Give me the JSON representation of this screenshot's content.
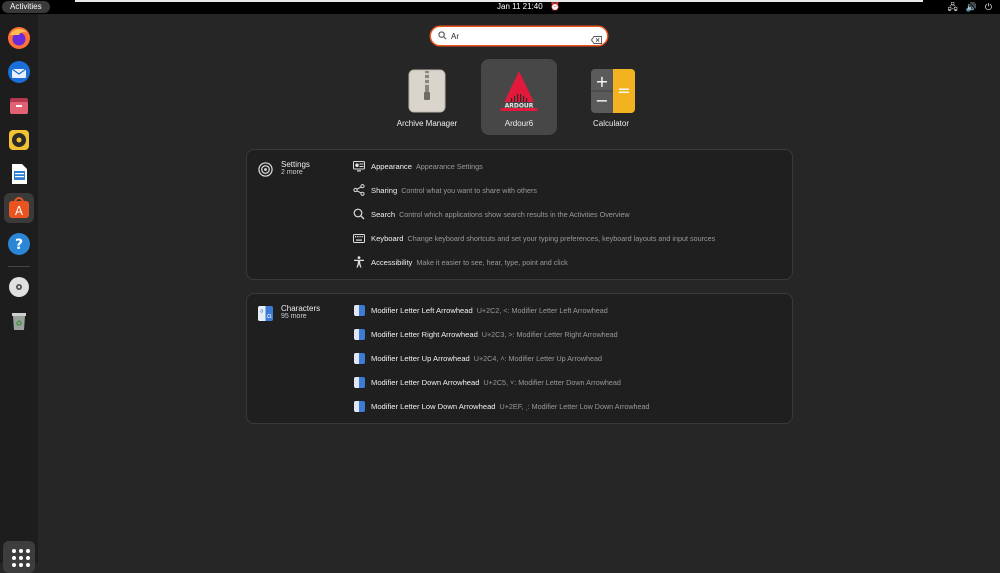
{
  "topbar": {
    "activities": "Activities",
    "clock": "Jan 11  21:40"
  },
  "dock": {
    "items": [
      "firefox-icon",
      "thunderbird-icon",
      "files-icon",
      "rhythmbox-icon",
      "writer-icon",
      "app-center-icon",
      "help-icon",
      "disc-icon",
      "trash-icon"
    ],
    "active": "app-center-icon"
  },
  "search": {
    "value": "Ar"
  },
  "apps": [
    {
      "name": "Archive Manager"
    },
    {
      "name": "Ardour6"
    },
    {
      "name": "Calculator"
    }
  ],
  "settings": {
    "provider": "Settings",
    "more": "2 more",
    "results": [
      {
        "title": "Appearance",
        "desc": "Appearance Settings",
        "icon": "appearance-icon"
      },
      {
        "title": "Sharing",
        "desc": "Control what you want to share with others",
        "icon": "share-icon"
      },
      {
        "title": "Search",
        "desc": "Control which applications show search results in the Activities Overview",
        "icon": "search-icon"
      },
      {
        "title": "Keyboard",
        "desc": "Change keyboard shortcuts and set your typing preferences, keyboard layouts and input sources",
        "icon": "keyboard-icon"
      },
      {
        "title": "Accessibility",
        "desc": "Make it easier to see, hear, type, point and click",
        "icon": "accessibility-icon"
      }
    ]
  },
  "characters": {
    "provider": "Characters",
    "more": "95 more",
    "results": [
      {
        "title": "Modifier Letter Left Arrowhead",
        "desc": "U+2C2, ˂: Modifier Letter Left Arrowhead"
      },
      {
        "title": "Modifier Letter Right Arrowhead",
        "desc": "U+2C3, ˃: Modifier Letter Right Arrowhead"
      },
      {
        "title": "Modifier Letter Up Arrowhead",
        "desc": "U+2C4, ˄: Modifier Letter Up Arrowhead"
      },
      {
        "title": "Modifier Letter Down Arrowhead",
        "desc": "U+2C5, ˅: Modifier Letter Down Arrowhead"
      },
      {
        "title": "Modifier Letter Low Down Arrowhead",
        "desc": "U+2EF, ˯: Modifier Letter Low Down Arrowhead"
      }
    ]
  }
}
